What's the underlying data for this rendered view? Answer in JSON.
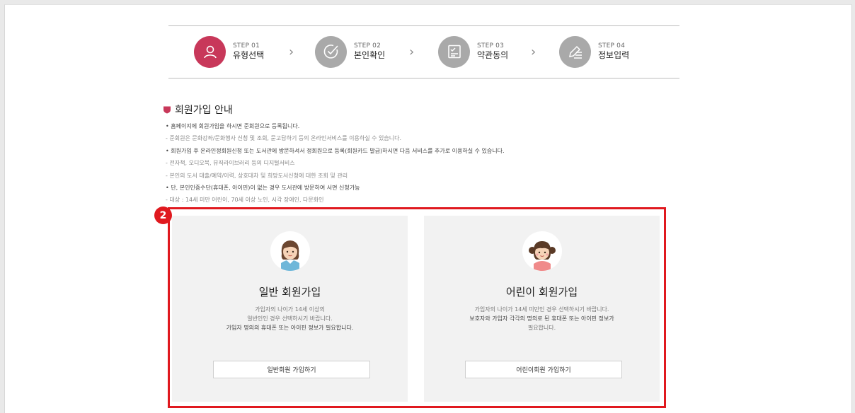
{
  "steps": [
    {
      "num": "STEP 01",
      "label": "유형선택",
      "icon": "person-icon",
      "active": true
    },
    {
      "num": "STEP 02",
      "label": "본인확인",
      "icon": "check-circle-icon",
      "active": false
    },
    {
      "num": "STEP 03",
      "label": "약관동의",
      "icon": "checklist-icon",
      "active": false
    },
    {
      "num": "STEP 04",
      "label": "정보입력",
      "icon": "pen-lines-icon",
      "active": false
    }
  ],
  "chevron": "›",
  "guide": {
    "title": "회원가입 안내",
    "lines": [
      {
        "type": "main",
        "text": "홈페이지에 회원가입을 하시면 준회원으로 등록됩니다."
      },
      {
        "type": "sub",
        "text": "준회원은 문화강좌/문화행사 신청 및 조회, 묻고답하기 등의 온라인서비스를 이용하실 수 있습니다."
      },
      {
        "type": "main",
        "text": "회원가입 후 온라인정회원신청 또는 도서관에 방문하셔서 정회원으로 등록(회원카드 발급)하시면 다음 서비스를 추가로 이용하실 수 있습니다."
      },
      {
        "type": "sub",
        "text": "전자책, 오디오북, 뮤직라이브러리 등의 디지털서비스"
      },
      {
        "type": "sub",
        "text": "본인의 도서 대출/예약/이력, 상호대차 및 희망도서신청에 대한 조회 및 관리"
      },
      {
        "type": "main",
        "text": "단, 본인인증수단(휴대폰, 아이핀)이 없는 경우 도서관에 방문하여 서면 신청가능"
      },
      {
        "type": "sub",
        "text": "대상 : 14세 미만 어린이, 70세 이상 노인, 시각 장애인, 다문화인"
      }
    ]
  },
  "badge": "2",
  "cards": {
    "general": {
      "title": "일반 회원가입",
      "desc1": "가입자의 나이가 14세 이상의",
      "desc2": "일반인인 경우 선택하시기 바랍니다.",
      "desc3": "가입자 명의의 휴대폰 또는 아이핀 정보가 필요합니다.",
      "button": "일반회원 가입하기"
    },
    "child": {
      "title": "어린이 회원가입",
      "desc1": "가입자의 나이가 14세 미만인 경우 선택하시기 바랍니다.",
      "desc2": "보호자와 가입자 각각의 명의로 된 휴대폰 또는 아이핀 정보가",
      "desc3": "필요합니다.",
      "button": "어린이회원 가입하기"
    }
  },
  "colors": {
    "accent": "#c8385a",
    "inactive_step": "#a9a9a9",
    "highlight": "#e0191f",
    "card_bg": "#f2f2f2"
  }
}
